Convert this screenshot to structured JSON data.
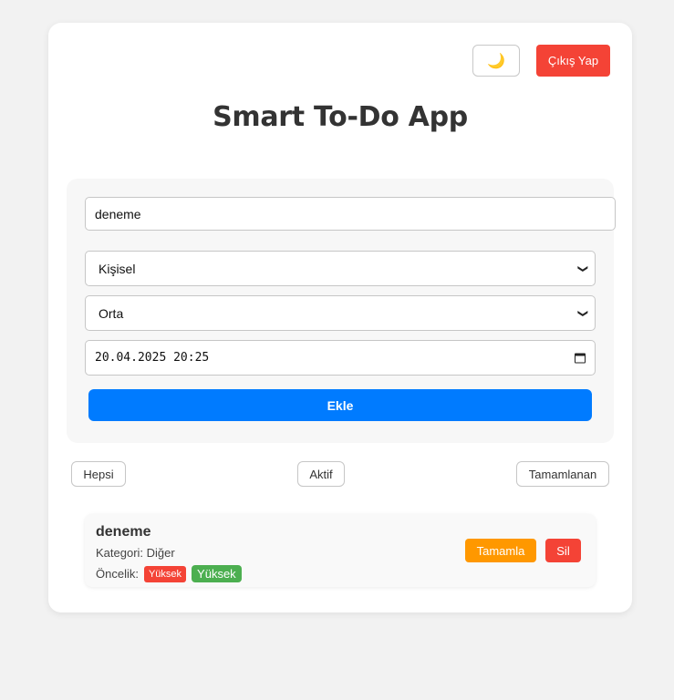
{
  "header": {
    "theme_toggle_icon": "🌙",
    "logout_label": "Çıkış Yap",
    "title": "Smart To-Do App"
  },
  "form": {
    "task_input_value": "deneme",
    "category_selected": "Kişisel",
    "priority_selected": "Orta",
    "due_datetime_value": "20.04.2025 20:25",
    "add_label": "Ekle"
  },
  "filters": {
    "all_label": "Hepsi",
    "active_label": "Aktif",
    "completed_label": "Tamamlanan"
  },
  "tasks": [
    {
      "title": "deneme",
      "category_label": "Kategori: Diğer",
      "priority_label": "Öncelik:",
      "badge_priority": "Yüksek",
      "badge_status": "Yüksek",
      "complete_label": "Tamamla",
      "delete_label": "Sil"
    }
  ],
  "colors": {
    "danger": "#f44336",
    "primary": "#007bff",
    "warning": "#ff9800",
    "success": "#4caf50",
    "background": "#f2f2f2"
  }
}
